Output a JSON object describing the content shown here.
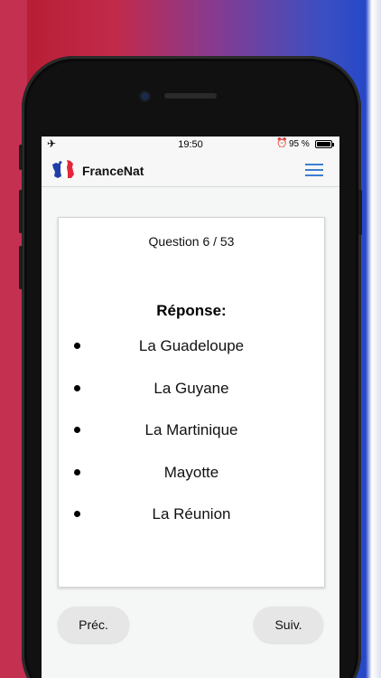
{
  "status_bar": {
    "airplane_icon": "airplane-icon",
    "time": "19:50",
    "alarm_icon": "alarm-icon",
    "battery_text": "95 %",
    "battery_icon": "battery-icon"
  },
  "app_bar": {
    "logo_icon": "france-map-flag-icon",
    "title": "FranceNat",
    "menu_icon": "hamburger-menu-icon",
    "menu_color": "#3b7fd0"
  },
  "card": {
    "counter": "Question 6 / 53",
    "answer_heading": "Réponse:",
    "answers": [
      "La Guadeloupe",
      "La Guyane",
      "La Martinique",
      "Mayotte",
      "La Réunion"
    ]
  },
  "nav": {
    "prev_label": "Préc.",
    "next_label": "Suiv."
  },
  "colors": {
    "flag_blue": "#1f3fa8",
    "flag_red": "#e3263a",
    "background_red": "#b41a2e",
    "background_blue": "#2046c8"
  }
}
